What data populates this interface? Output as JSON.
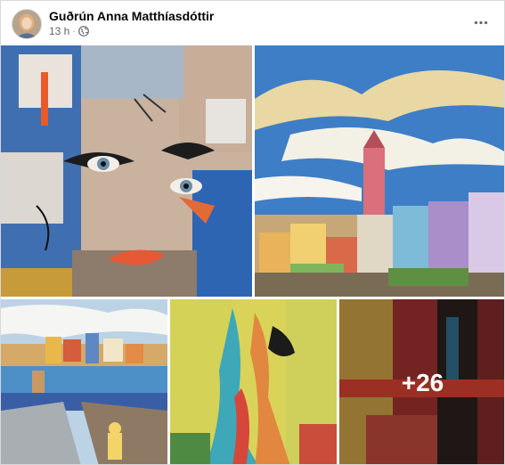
{
  "post": {
    "author": "Guðrún Anna Matthíasdóttir",
    "time": "13 h",
    "separator": "·",
    "more_count": "+26"
  },
  "icons": {
    "avatar": "profile-photo",
    "audience": "globe-icon",
    "menu": "more-options-icon"
  },
  "gallery": {
    "photos": [
      {
        "label": "abstract portrait painting"
      },
      {
        "label": "coastal town painting"
      },
      {
        "label": "harbor pier painting"
      },
      {
        "label": "abstract figure painting"
      },
      {
        "label": "abstract red painting"
      }
    ]
  },
  "colors": {
    "meta_text": "#65676b",
    "author_text": "#050505"
  }
}
